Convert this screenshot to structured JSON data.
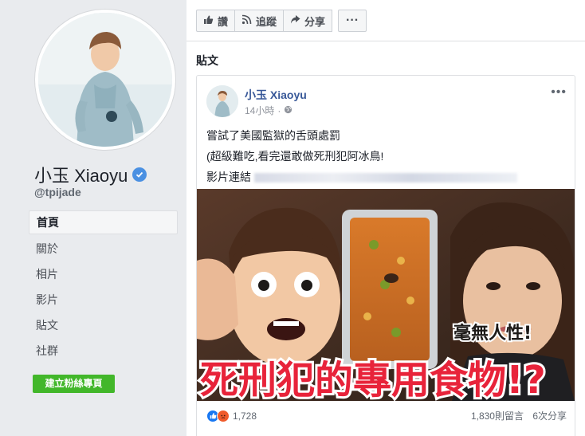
{
  "page": {
    "name": "小玉 Xiaoyu",
    "handle": "@tpijade"
  },
  "nav": {
    "items": [
      {
        "label": "首頁",
        "active": true
      },
      {
        "label": "關於",
        "active": false
      },
      {
        "label": "相片",
        "active": false
      },
      {
        "label": "影片",
        "active": false
      },
      {
        "label": "貼文",
        "active": false
      },
      {
        "label": "社群",
        "active": false
      }
    ],
    "create_button": "建立粉絲專頁"
  },
  "toolbar": {
    "like_label": "讚",
    "follow_label": "追蹤",
    "share_label": "分享",
    "more_label": "···"
  },
  "section": {
    "title": "貼文"
  },
  "post": {
    "author": "小玉 Xiaoyu",
    "time": "14小時",
    "privacy_icon": "globe-icon",
    "lines": [
      "嘗試了美國監獄的舌頭處罰",
      "(超級難吃,看完還敢做死刑犯阿冰鳥!",
      "影片連結"
    ],
    "image_caption_main": "死刑犯的專用食物!?",
    "image_caption_side": "毫無人性!",
    "reactions_count": "1,728",
    "comments": "1,830則留言",
    "shares": "6次分享"
  },
  "colors": {
    "page_bg": "#e9ebee",
    "link_blue": "#385898",
    "accent_green": "#42b72a",
    "like_blue": "#1877f2",
    "angry_orange": "#f05a2a",
    "caption_red": "#e8233a"
  }
}
